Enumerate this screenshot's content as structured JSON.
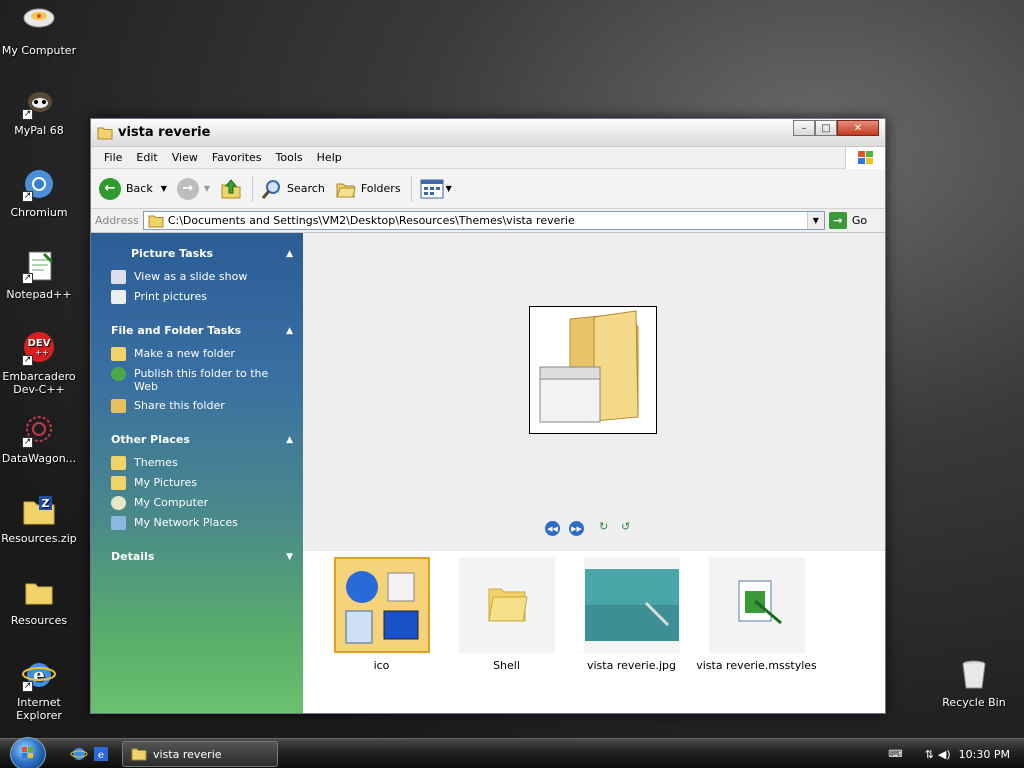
{
  "desktop": {
    "icons": [
      {
        "label": "My Computer"
      },
      {
        "label": "MyPal 68"
      },
      {
        "label": "Chromium"
      },
      {
        "label": "Notepad++"
      },
      {
        "label": "Embarcadero Dev-C++"
      },
      {
        "label": "DataWagon..."
      },
      {
        "label": "Resources.zip"
      },
      {
        "label": "Resources"
      },
      {
        "label": "Internet Explorer"
      },
      {
        "label": "Recycle Bin"
      }
    ]
  },
  "window": {
    "title": "vista reverie",
    "menu": [
      "File",
      "Edit",
      "View",
      "Favorites",
      "Tools",
      "Help"
    ],
    "toolbar": {
      "back": "Back",
      "search": "Search",
      "folders": "Folders"
    },
    "address": {
      "label": "Address",
      "value": "C:\\Documents and Settings\\VM2\\Desktop\\Resources\\Themes\\vista reverie",
      "go": "Go"
    }
  },
  "taskpane": {
    "picture_tasks": {
      "title": "Picture Tasks",
      "links": [
        "View as a slide show",
        "Print pictures"
      ]
    },
    "file_tasks": {
      "title": "File and Folder Tasks",
      "links": [
        "Make a new folder",
        "Publish this folder to the Web",
        "Share this folder"
      ]
    },
    "other_places": {
      "title": "Other Places",
      "links": [
        "Themes",
        "My Pictures",
        "My Computer",
        "My Network Places"
      ]
    },
    "details": {
      "title": "Details"
    }
  },
  "files": [
    {
      "name": "ico"
    },
    {
      "name": "Shell"
    },
    {
      "name": "vista reverie.jpg"
    },
    {
      "name": "vista reverie.msstyles"
    }
  ],
  "taskbar": {
    "task": "vista reverie",
    "clock": "10:30 PM"
  }
}
